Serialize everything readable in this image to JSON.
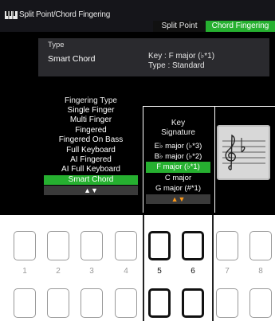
{
  "titlebar": {
    "title": "Split Point/Chord Fingering"
  },
  "tabs": [
    {
      "label": "Split Point",
      "active": false
    },
    {
      "label": "Chord Fingering",
      "active": true
    }
  ],
  "type_panel": {
    "label": "Type",
    "value": "Smart Chord",
    "key_line": "Key : F major (♭*1)",
    "type_line": "Type : Standard"
  },
  "fingering_list": {
    "heading": "Fingering Type",
    "items": [
      "Single Finger",
      "Multi Finger",
      "Fingered",
      "Fingered On Bass",
      "Full Keyboard",
      "AI Fingered",
      "AI Full Keyboard",
      "Smart Chord"
    ],
    "selected": "Smart Chord",
    "scroll": "▲▼"
  },
  "key_list": {
    "heading_line1": "Key",
    "heading_line2": "Signature",
    "items": [
      "E♭ major (♭*3)",
      "B♭ major (♭*2)",
      "F major (♭*1)",
      "C major",
      "G major (#*1)"
    ],
    "selected": "F major (♭*1)",
    "scroll": "▲▼"
  },
  "panel_buttons": [
    "1",
    "2",
    "3",
    "4",
    "5",
    "6",
    "7",
    "8"
  ],
  "colors": {
    "accent": "#26b030",
    "scroll_orange": "#ff9a1a",
    "screen_bg": "#000000"
  },
  "icons": [
    "keyboard-icon",
    "treble-clef-icon",
    "flat-icon"
  ]
}
